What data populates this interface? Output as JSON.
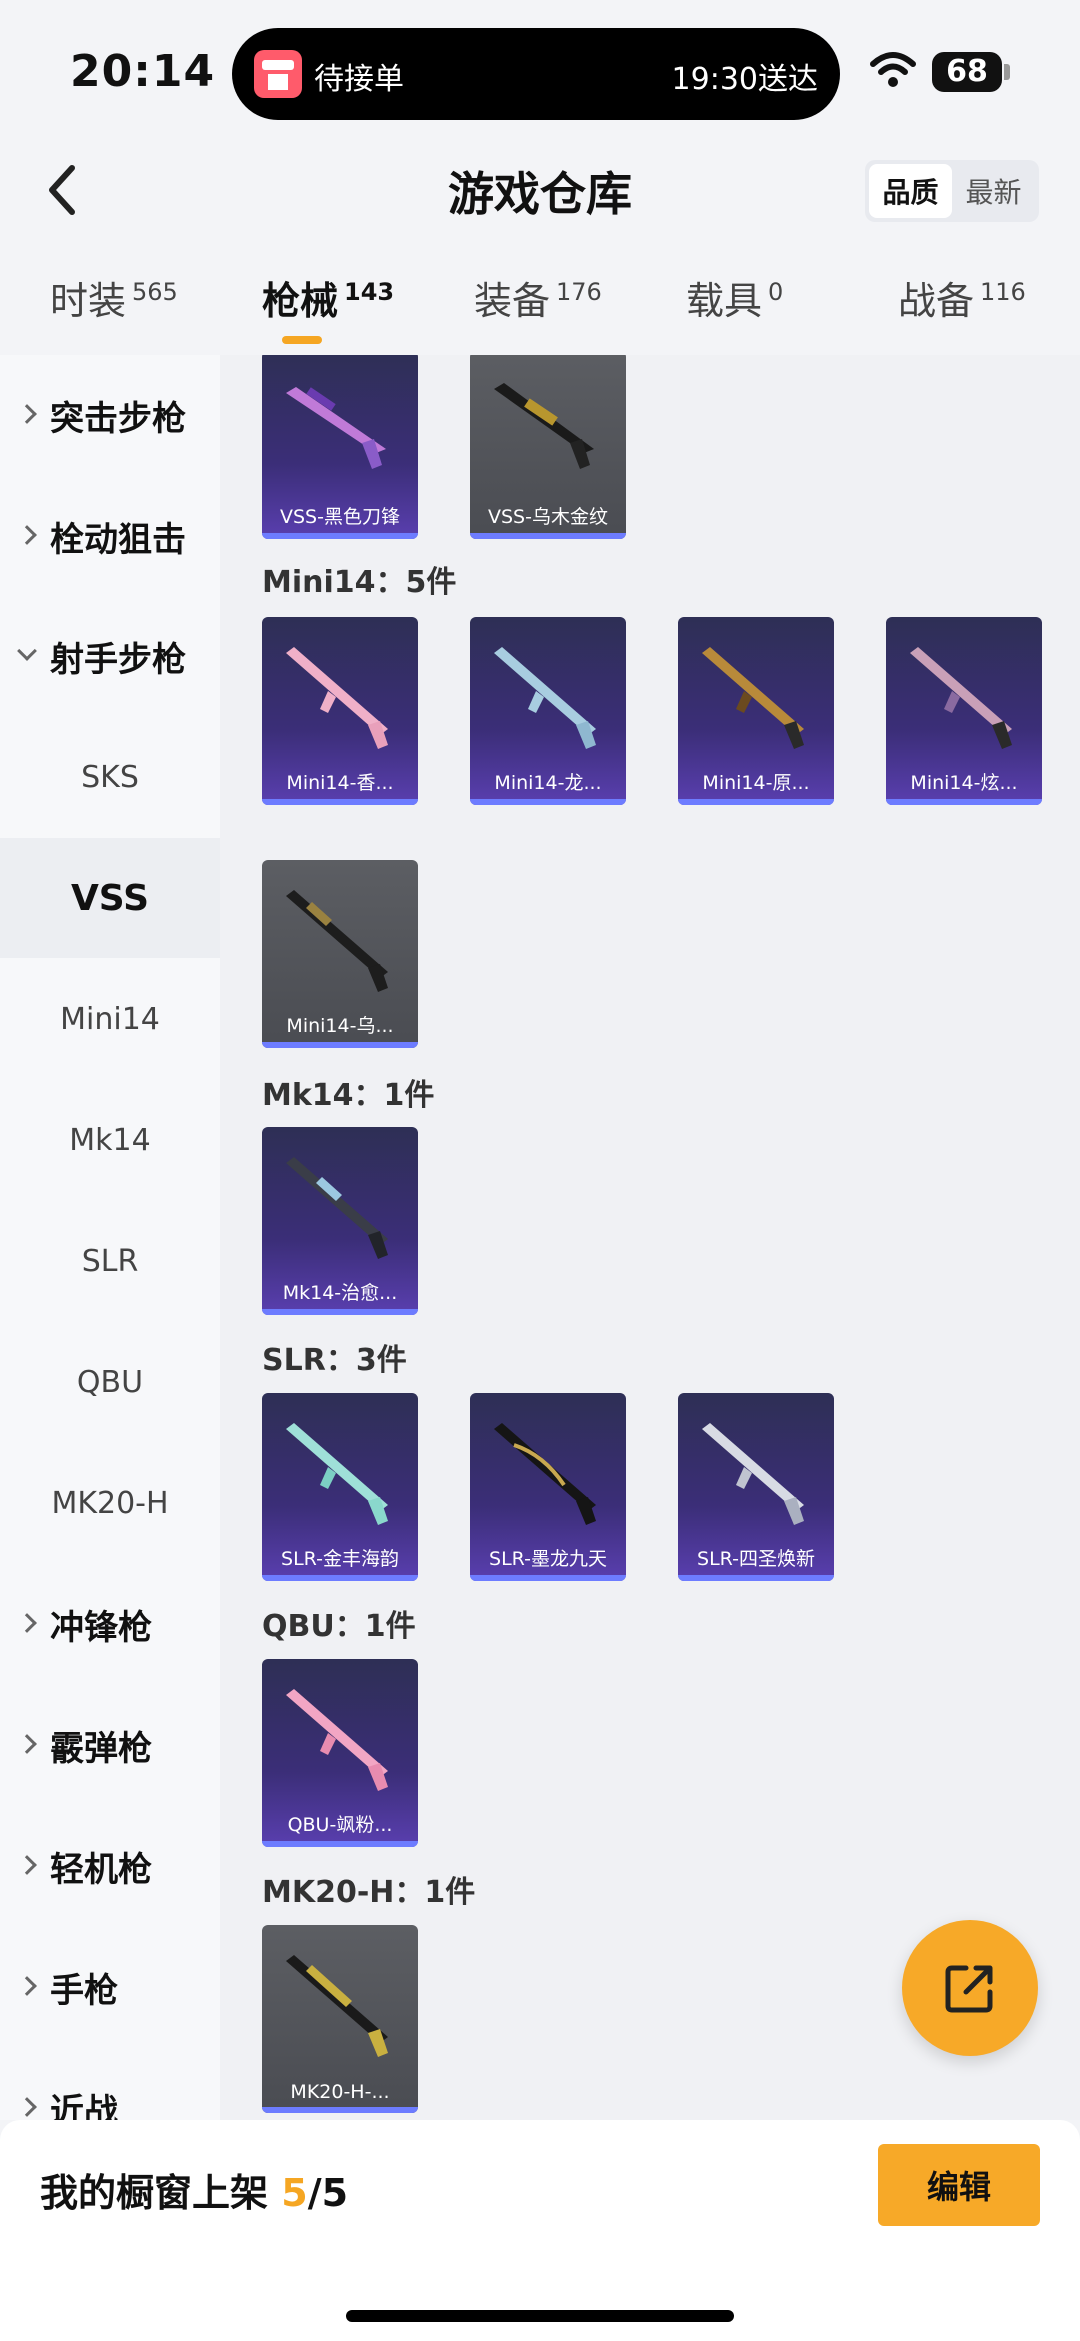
{
  "status": {
    "time": "20:14",
    "island_label": "待接单",
    "island_eta": "19:30送达",
    "battery": "68"
  },
  "header": {
    "title": "游戏仓库",
    "sort_quality": "品质",
    "sort_newest": "最新"
  },
  "tabs": [
    {
      "label": "时装",
      "count": "565"
    },
    {
      "label": "枪械",
      "count": "143"
    },
    {
      "label": "装备",
      "count": "176"
    },
    {
      "label": "载具",
      "count": "0"
    },
    {
      "label": "战备",
      "count": "116"
    }
  ],
  "sidebar": {
    "categories": [
      {
        "label": "突击步枪"
      },
      {
        "label": "栓动狙击"
      },
      {
        "label": "射手步枪"
      }
    ],
    "subitems": [
      "SKS",
      "VSS",
      "Mini14",
      "Mk14",
      "SLR",
      "QBU",
      "MK20-H"
    ],
    "more_categories": [
      {
        "label": "冲锋枪"
      },
      {
        "label": "霰弹枪"
      },
      {
        "label": "轻机枪"
      },
      {
        "label": "手枪"
      },
      {
        "label": "近战"
      }
    ]
  },
  "groups": {
    "mini14_title": "Mini14：5件",
    "mk14_title": "Mk14：1件",
    "slr_title": "SLR：3件",
    "qbu_title": "QBU：1件",
    "mk20_title": "MK20-H：1件"
  },
  "cards": {
    "vss1": "VSS-黑色刀锋",
    "vss2": "VSS-乌木金纹",
    "mini1": "Mini14-香...",
    "mini2": "Mini14-龙...",
    "mini3": "Mini14-原...",
    "mini4": "Mini14-炫...",
    "mini5": "Mini14-乌...",
    "mk14": "Mk14-治愈...",
    "slr1": "SLR-金丰海韵",
    "slr2": "SLR-墨龙九天",
    "slr3": "SLR-四圣焕新",
    "qbu": "QBU-飒粉...",
    "mk20": "MK20-H-..."
  },
  "bottom": {
    "shelf_label": "我的橱窗上架",
    "shelf_used": "5",
    "shelf_total": "/5",
    "edit_label": "编辑"
  },
  "colors": {
    "accent": "#f7a928",
    "card_purple": "#3b2e78",
    "card_gray": "#4a4c52",
    "card_bar": "#6d7cff"
  }
}
